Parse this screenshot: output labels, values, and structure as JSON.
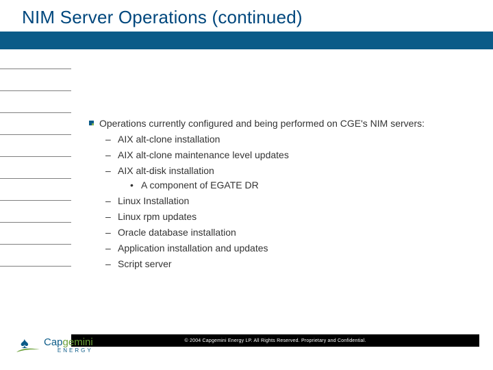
{
  "title": "NIM Server Operations (continued)",
  "lead": "Operations currently configured and being performed on CGE's NIM servers:",
  "items": [
    {
      "label": "AIX alt-clone installation"
    },
    {
      "label": "AIX alt-clone maintenance level updates"
    },
    {
      "label": "AIX alt-disk installation",
      "sub": [
        "A component of EGATE DR"
      ]
    },
    {
      "label": "Linux Installation"
    },
    {
      "label": "Linux rpm updates"
    },
    {
      "label": "Oracle database installation"
    },
    {
      "label": "Application installation and updates"
    },
    {
      "label": "Script server"
    }
  ],
  "footer": "© 2004 Capgemini Energy LP.  All Rights Reserved.  Proprietary and Confidential.",
  "logo": {
    "brand": "Capgemini",
    "sub": "ENERGY"
  }
}
